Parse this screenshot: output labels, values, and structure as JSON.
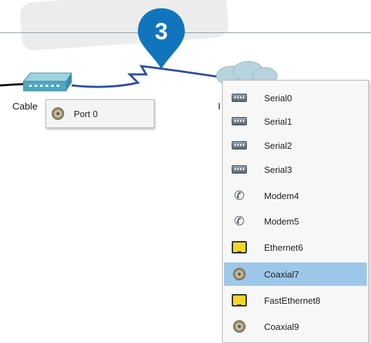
{
  "topology": {
    "cable_label": "Cable",
    "right_device_label": "I",
    "step_badge": "3"
  },
  "port_popup": {
    "item": {
      "label": "Port 0",
      "icon": "coaxial-port-icon"
    }
  },
  "interface_menu": {
    "items": [
      {
        "label": "Serial0",
        "icon": "serial-port-icon",
        "selected": false
      },
      {
        "label": "Serial1",
        "icon": "serial-port-icon",
        "selected": false
      },
      {
        "label": "Serial2",
        "icon": "serial-port-icon",
        "selected": false
      },
      {
        "label": "Serial3",
        "icon": "serial-port-icon",
        "selected": false
      },
      {
        "label": "Modem4",
        "icon": "modem-port-icon",
        "selected": false
      },
      {
        "label": "Modem5",
        "icon": "modem-port-icon",
        "selected": false
      },
      {
        "label": "Ethernet6",
        "icon": "ethernet-port-icon",
        "selected": false
      },
      {
        "label": "Coaxial7",
        "icon": "coaxial-port-icon",
        "selected": true
      },
      {
        "label": "FastEthernet8",
        "icon": "ethernet-port-icon",
        "selected": false
      },
      {
        "label": "Coaxial9",
        "icon": "coaxial-port-icon",
        "selected": false
      }
    ]
  },
  "colors": {
    "badge": "#1075bd",
    "link": "#2b4f9e",
    "selection": "#9dc7ea",
    "device": "#5fb3c9"
  }
}
